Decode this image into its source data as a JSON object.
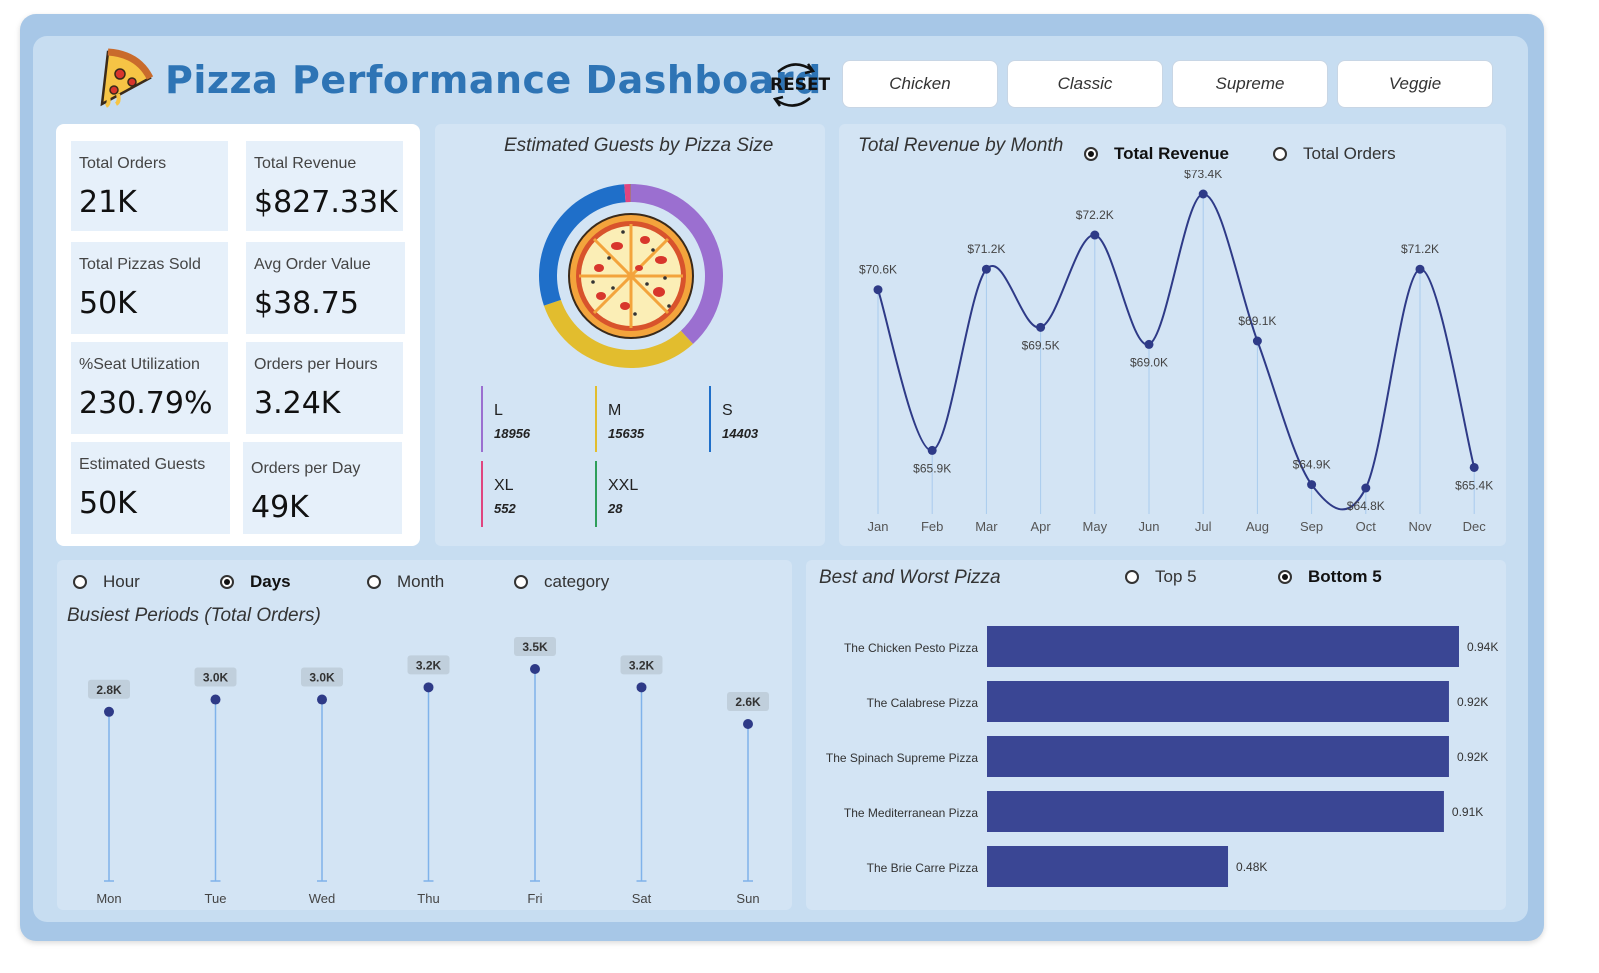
{
  "header": {
    "title": "Pizza Performance Dashboard",
    "reset_label": "RESET",
    "filters": [
      "Chicken",
      "Classic",
      "Supreme",
      "Veggie"
    ]
  },
  "kpis": [
    {
      "label": "Total Orders",
      "value": "21K"
    },
    {
      "label": "Total Revenue",
      "value": "$827.33K"
    },
    {
      "label": "Total Pizzas Sold",
      "value": "50K"
    },
    {
      "label": "Avg Order Value",
      "value": "$38.75"
    },
    {
      "label": "%Seat Utilization",
      "value": "230.79%"
    },
    {
      "label": "Orders per Hours",
      "value": "3.24K"
    },
    {
      "label": "Estimated Guests",
      "value": "50K"
    },
    {
      "label": "Orders per Day",
      "value": "49K"
    }
  ],
  "donut": {
    "title": "Estimated Guests by Pizza Size",
    "legend": [
      {
        "name": "L",
        "value": "18956",
        "color": "#9b6fd0"
      },
      {
        "name": "M",
        "value": "15635",
        "color": "#e2bd2e"
      },
      {
        "name": "S",
        "value": "14403",
        "color": "#1f6fc9"
      },
      {
        "name": "XL",
        "value": "552",
        "color": "#e0457f"
      },
      {
        "name": "XXL",
        "value": "28",
        "color": "#2e9e5a"
      }
    ]
  },
  "revenue": {
    "title": "Total Revenue by Month",
    "options": [
      {
        "label": "Total Revenue",
        "selected": true
      },
      {
        "label": "Total Orders",
        "selected": false
      }
    ]
  },
  "busiest": {
    "title": "Busiest Periods (Total Orders)",
    "options": [
      {
        "label": "Hour",
        "selected": false
      },
      {
        "label": "Days",
        "selected": true
      },
      {
        "label": "Month",
        "selected": false
      },
      {
        "label": "category",
        "selected": false
      }
    ]
  },
  "bestworst": {
    "title": "Best and Worst Pizza",
    "options": [
      {
        "label": "Top 5",
        "selected": false
      },
      {
        "label": "Bottom 5",
        "selected": true
      }
    ]
  },
  "chart_data": [
    {
      "type": "pie",
      "title": "Estimated Guests by Pizza Size",
      "categories": [
        "L",
        "M",
        "S",
        "XL",
        "XXL"
      ],
      "values": [
        18956,
        15635,
        14403,
        552,
        28
      ],
      "colors": [
        "#9b6fd0",
        "#e2bd2e",
        "#1f6fc9",
        "#e0457f",
        "#2e9e5a"
      ]
    },
    {
      "type": "line",
      "title": "Total Revenue by Month",
      "categories": [
        "Jan",
        "Feb",
        "Mar",
        "Apr",
        "May",
        "Jun",
        "Jul",
        "Aug",
        "Sep",
        "Oct",
        "Nov",
        "Dec"
      ],
      "values": [
        70.6,
        65.9,
        71.2,
        69.5,
        72.2,
        69.0,
        73.4,
        69.1,
        64.9,
        64.8,
        71.2,
        65.4
      ],
      "labels": [
        "$70.6K",
        "$65.9K",
        "$71.2K",
        "$69.5K",
        "$72.2K",
        "$69.0K",
        "$73.4K",
        "$69.1K",
        "$64.9K",
        "$64.8K",
        "$71.2K",
        "$65.4K"
      ],
      "color": "#2e3a87"
    },
    {
      "type": "scatter",
      "title": "Busiest Periods (Total Orders)",
      "categories": [
        "Mon",
        "Tue",
        "Wed",
        "Thu",
        "Fri",
        "Sat",
        "Sun"
      ],
      "values": [
        2.8,
        3.0,
        3.0,
        3.2,
        3.5,
        3.2,
        2.6
      ],
      "labels": [
        "2.8K",
        "3.0K",
        "3.0K",
        "3.2K",
        "3.5K",
        "3.2K",
        "2.6K"
      ],
      "color": "#2e3a87"
    },
    {
      "type": "bar",
      "title": "Best and Worst Pizza",
      "categories": [
        "The Chicken Pesto Pizza",
        "The Calabrese Pizza",
        "The Spinach Supreme Pizza",
        "The Mediterranean Pizza",
        "The Brie Carre Pizza"
      ],
      "values": [
        0.94,
        0.92,
        0.92,
        0.91,
        0.48
      ],
      "labels": [
        "0.94K",
        "0.92K",
        "0.92K",
        "0.91K",
        "0.48K"
      ],
      "color": "#3a4694"
    }
  ]
}
